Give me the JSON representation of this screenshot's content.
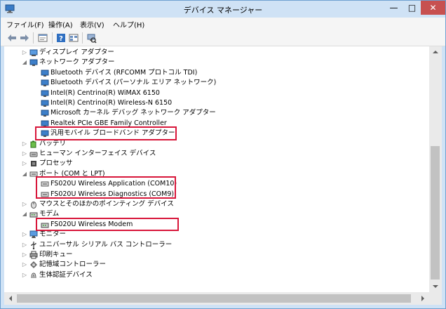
{
  "window": {
    "title": "デバイス マネージャー",
    "controls": {
      "minimize": "—",
      "maximize": "□",
      "close": "✕"
    }
  },
  "menu": {
    "items": [
      "ファイル(F)",
      "操作(A)",
      "表示(V)",
      "ヘルプ(H)"
    ]
  },
  "toolbar": {
    "buttons": [
      "back-arrow-icon",
      "forward-arrow-icon",
      "properties-icon",
      "help-icon",
      "view-icon",
      "scan-hardware-icon"
    ]
  },
  "tree": {
    "items": [
      {
        "label": "ディスプレイ アダプター",
        "level": 0,
        "expander": "collapsed",
        "icon": "display-adapter-icon"
      },
      {
        "label": "ネットワーク アダプター",
        "level": 0,
        "expander": "expanded",
        "icon": "network-adapter-icon"
      },
      {
        "label": "Bluetooth デバイス (RFCOMM プロトコル TDI)",
        "level": 1,
        "expander": "none",
        "icon": "network-device-icon"
      },
      {
        "label": "Bluetooth デバイス (パーソナル エリア ネットワーク)",
        "level": 1,
        "expander": "none",
        "icon": "network-device-icon"
      },
      {
        "label": "Intel(R) Centrino(R) WiMAX 6150",
        "level": 1,
        "expander": "none",
        "icon": "network-device-icon"
      },
      {
        "label": "Intel(R) Centrino(R) Wireless-N 6150",
        "level": 1,
        "expander": "none",
        "icon": "network-device-icon"
      },
      {
        "label": "Microsoft カーネル デバッグ ネットワーク アダプター",
        "level": 1,
        "expander": "none",
        "icon": "network-device-icon"
      },
      {
        "label": "Realtek PCIe GBE Family Controller",
        "level": 1,
        "expander": "none",
        "icon": "network-device-icon"
      },
      {
        "label": "汎用モバイル ブロードバンド アダプター",
        "level": 1,
        "expander": "none",
        "icon": "network-device-icon"
      },
      {
        "label": "バッテリ",
        "level": 0,
        "expander": "collapsed",
        "icon": "battery-icon"
      },
      {
        "label": "ヒューマン インターフェイス デバイス",
        "level": 0,
        "expander": "collapsed",
        "icon": "hid-icon"
      },
      {
        "label": "プロセッサ",
        "level": 0,
        "expander": "collapsed",
        "icon": "processor-icon"
      },
      {
        "label": "ポート (COM と LPT)",
        "level": 0,
        "expander": "expanded",
        "icon": "port-icon"
      },
      {
        "label": "FS020U Wireless Application (COM10)",
        "level": 1,
        "expander": "none",
        "icon": "port-icon"
      },
      {
        "label": "FS020U Wireless Diagnostics (COM9)",
        "level": 1,
        "expander": "none",
        "icon": "port-icon"
      },
      {
        "label": "マウスとそのほかのポインティング デバイス",
        "level": 0,
        "expander": "collapsed",
        "icon": "mouse-icon"
      },
      {
        "label": "モデム",
        "level": 0,
        "expander": "expanded",
        "icon": "modem-icon"
      },
      {
        "label": "FS020U Wireless Modem",
        "level": 1,
        "expander": "none",
        "icon": "modem-icon"
      },
      {
        "label": "モニター",
        "level": 0,
        "expander": "collapsed",
        "icon": "monitor-icon"
      },
      {
        "label": "ユニバーサル シリアル バス コントローラー",
        "level": 0,
        "expander": "collapsed",
        "icon": "usb-icon"
      },
      {
        "label": "印刷キュー",
        "level": 0,
        "expander": "collapsed",
        "icon": "print-queue-icon"
      },
      {
        "label": "記憶域コントローラー",
        "level": 0,
        "expander": "collapsed",
        "icon": "storage-icon"
      },
      {
        "label": "生体認証デバイス",
        "level": 0,
        "expander": "collapsed",
        "icon": "biometric-icon"
      }
    ]
  },
  "colors": {
    "highlight_border": "#d8163a",
    "close_button": "#c75050",
    "window_frame": "#cfe2f5"
  }
}
